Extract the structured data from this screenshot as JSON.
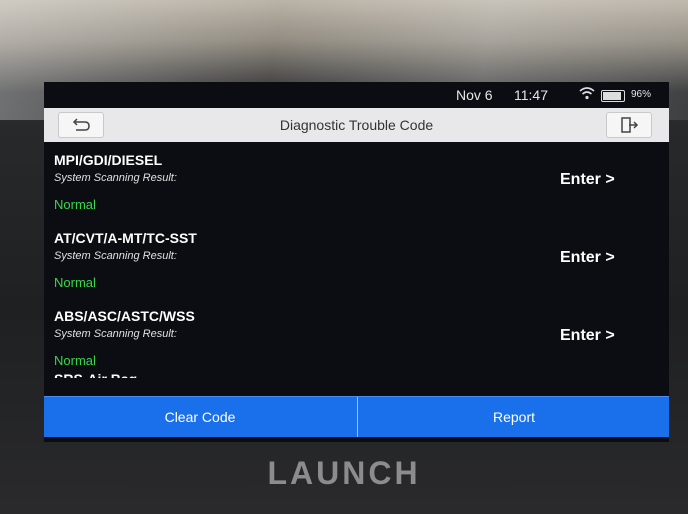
{
  "status": {
    "date": "Nov 6",
    "time": "11:47",
    "battery": "96%"
  },
  "header": {
    "title": "Diagnostic Trouble Code"
  },
  "systems": [
    {
      "name": "MPI/GDI/DIESEL",
      "subtitle": "System Scanning Result:",
      "status": "Normal",
      "action": "Enter >"
    },
    {
      "name": "AT/CVT/A-MT/TC-SST",
      "subtitle": "System Scanning Result:",
      "status": "Normal",
      "action": "Enter >"
    },
    {
      "name": "ABS/ASC/ASTC/WSS",
      "subtitle": "System Scanning Result:",
      "status": "Normal",
      "action": "Enter >"
    }
  ],
  "partial_item": "SRS-Air Bag",
  "buttons": {
    "clear": "Clear Code",
    "report": "Report"
  },
  "brand": "LAUNCH",
  "colors": {
    "accent": "#1a70ea",
    "normal_status": "#35d94a"
  }
}
